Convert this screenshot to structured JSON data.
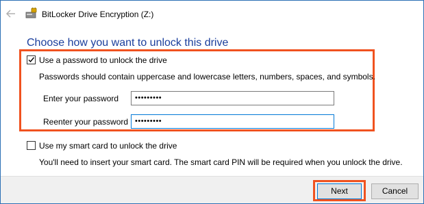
{
  "window": {
    "title": "BitLocker Drive Encryption (Z:)"
  },
  "main": {
    "heading": "Choose how you want to unlock this drive",
    "password_option": {
      "label": "Use a password to unlock the drive",
      "checked": true,
      "hint": "Passwords should contain uppercase and lowercase letters, numbers, spaces, and symbols.",
      "enter_label": "Enter your password",
      "enter_value": "•••••••••",
      "reenter_label": "Reenter your password",
      "reenter_value": "•••••••••"
    },
    "smartcard_option": {
      "label": "Use my smart card to unlock the drive",
      "checked": false,
      "hint": "You'll need to insert your smart card. The smart card PIN will be required when you unlock the drive."
    }
  },
  "footer": {
    "next_label": "Next",
    "cancel_label": "Cancel"
  },
  "colors": {
    "heading": "#1a3e9c",
    "highlight": "#f0521f",
    "focus_border": "#0078d7"
  },
  "icons": {
    "back": "back-arrow-icon",
    "app": "bitlocker-drive-icon"
  }
}
